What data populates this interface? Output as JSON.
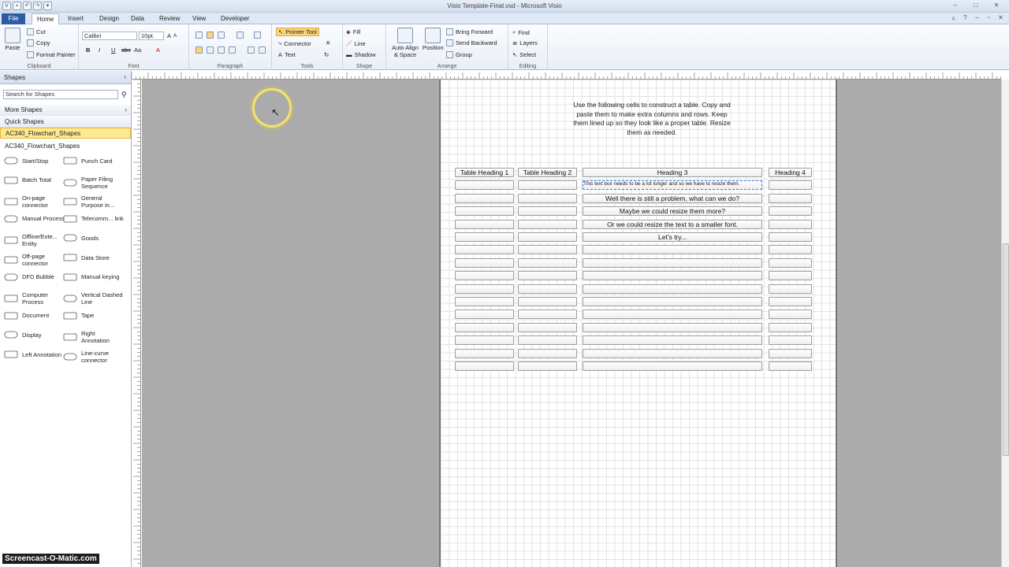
{
  "window": {
    "title": "Visio Template-Final.vsd  -  Microsoft Visio"
  },
  "tabs": [
    "File",
    "Home",
    "Insert",
    "Design",
    "Data",
    "Review",
    "View",
    "Developer"
  ],
  "ribbon": {
    "clipboard": {
      "paste": "Paste",
      "cut": "Cut",
      "copy": "Copy",
      "format_painter": "Format Painter",
      "label": "Clipboard"
    },
    "font": {
      "name": "Calibri",
      "size": "10pt.",
      "bold": "B",
      "italic": "I",
      "underline": "U",
      "strike": "abc",
      "case": "Aa",
      "color": "A",
      "label": "Font"
    },
    "paragraph": {
      "label": "Paragraph"
    },
    "tools": {
      "pointer": "Pointer Tool",
      "connector": "Connector",
      "text": "Text",
      "label": "Tools"
    },
    "shape": {
      "fill": "Fill",
      "line": "Line",
      "shadow": "Shadow",
      "label": "Shape"
    },
    "arrange": {
      "auto_align": "Auto Align & Space",
      "position": "Position",
      "bring_forward": "Bring Forward",
      "send_backward": "Send Backward",
      "group": "Group",
      "label": "Arrange"
    },
    "editing": {
      "find": "Find",
      "layers": "Layers",
      "select": "Select",
      "label": "Editing"
    }
  },
  "shapes_panel": {
    "title": "Shapes",
    "search_placeholder": "Search for Shapes",
    "more_shapes": "More Shapes",
    "quick_shapes": "Quick Shapes",
    "stencil": "AC340_Flowchart_Shapes",
    "stencil_title": "AC340_Flowchart_Shapes",
    "items": [
      {
        "label": "Start/Stop",
        "icon": "terminator-icon"
      },
      {
        "label": "Punch Card",
        "icon": "punch-card-icon"
      },
      {
        "label": "Batch Total",
        "icon": "batch-total-icon"
      },
      {
        "label": "Paper Filing Sequence",
        "icon": "paper-filing-icon"
      },
      {
        "label": "On-page connector",
        "icon": "circle-icon"
      },
      {
        "label": "General Purpose in...",
        "icon": "parallelogram-icon"
      },
      {
        "label": "Manual Process",
        "icon": "trapezoid-icon"
      },
      {
        "label": "Telecomm... link",
        "icon": "telecomm-link-icon"
      },
      {
        "label": "Offline/Exte... Entity",
        "icon": "offline-entity-icon"
      },
      {
        "label": "Goods",
        "icon": "goods-icon"
      },
      {
        "label": "Off-page connector",
        "icon": "off-page-connector-icon"
      },
      {
        "label": "Data Store",
        "icon": "data-store-icon"
      },
      {
        "label": "DFD Bubble",
        "icon": "dfd-bubble-icon"
      },
      {
        "label": "Manual keying",
        "icon": "manual-keying-icon"
      },
      {
        "label": "Computer Process",
        "icon": "computer-process-icon"
      },
      {
        "label": "Vertical Dashed Line",
        "icon": "dashed-line-icon"
      },
      {
        "label": "Document",
        "icon": "document-icon"
      },
      {
        "label": "Tape",
        "icon": "tape-icon"
      },
      {
        "label": "Display",
        "icon": "display-icon"
      },
      {
        "label": "Right Annotation",
        "icon": "right-annotation-icon"
      },
      {
        "label": "Left Annotation",
        "icon": "left-annotation-icon"
      },
      {
        "label": "Line-curve connector",
        "icon": "line-curve-icon"
      }
    ]
  },
  "drawing": {
    "instructions": "Use the following cells to construct a table. Copy and paste them to make extra columns and rows. Keep them lined up so they look like a proper table. Resize them as needed.",
    "headings": [
      "Table Heading 1",
      "Table Heading 2",
      "Heading 3",
      "Heading 4"
    ],
    "col3_rows": [
      "This text box needs to be a lot longer and so we have to resize them.",
      "Well there is still a problem, what can we do?",
      "Maybe we could resize them more?",
      "Or we could resize the text to a smaller font.",
      "Let's try..."
    ]
  },
  "watermark": "Screencast-O-Matic.com"
}
